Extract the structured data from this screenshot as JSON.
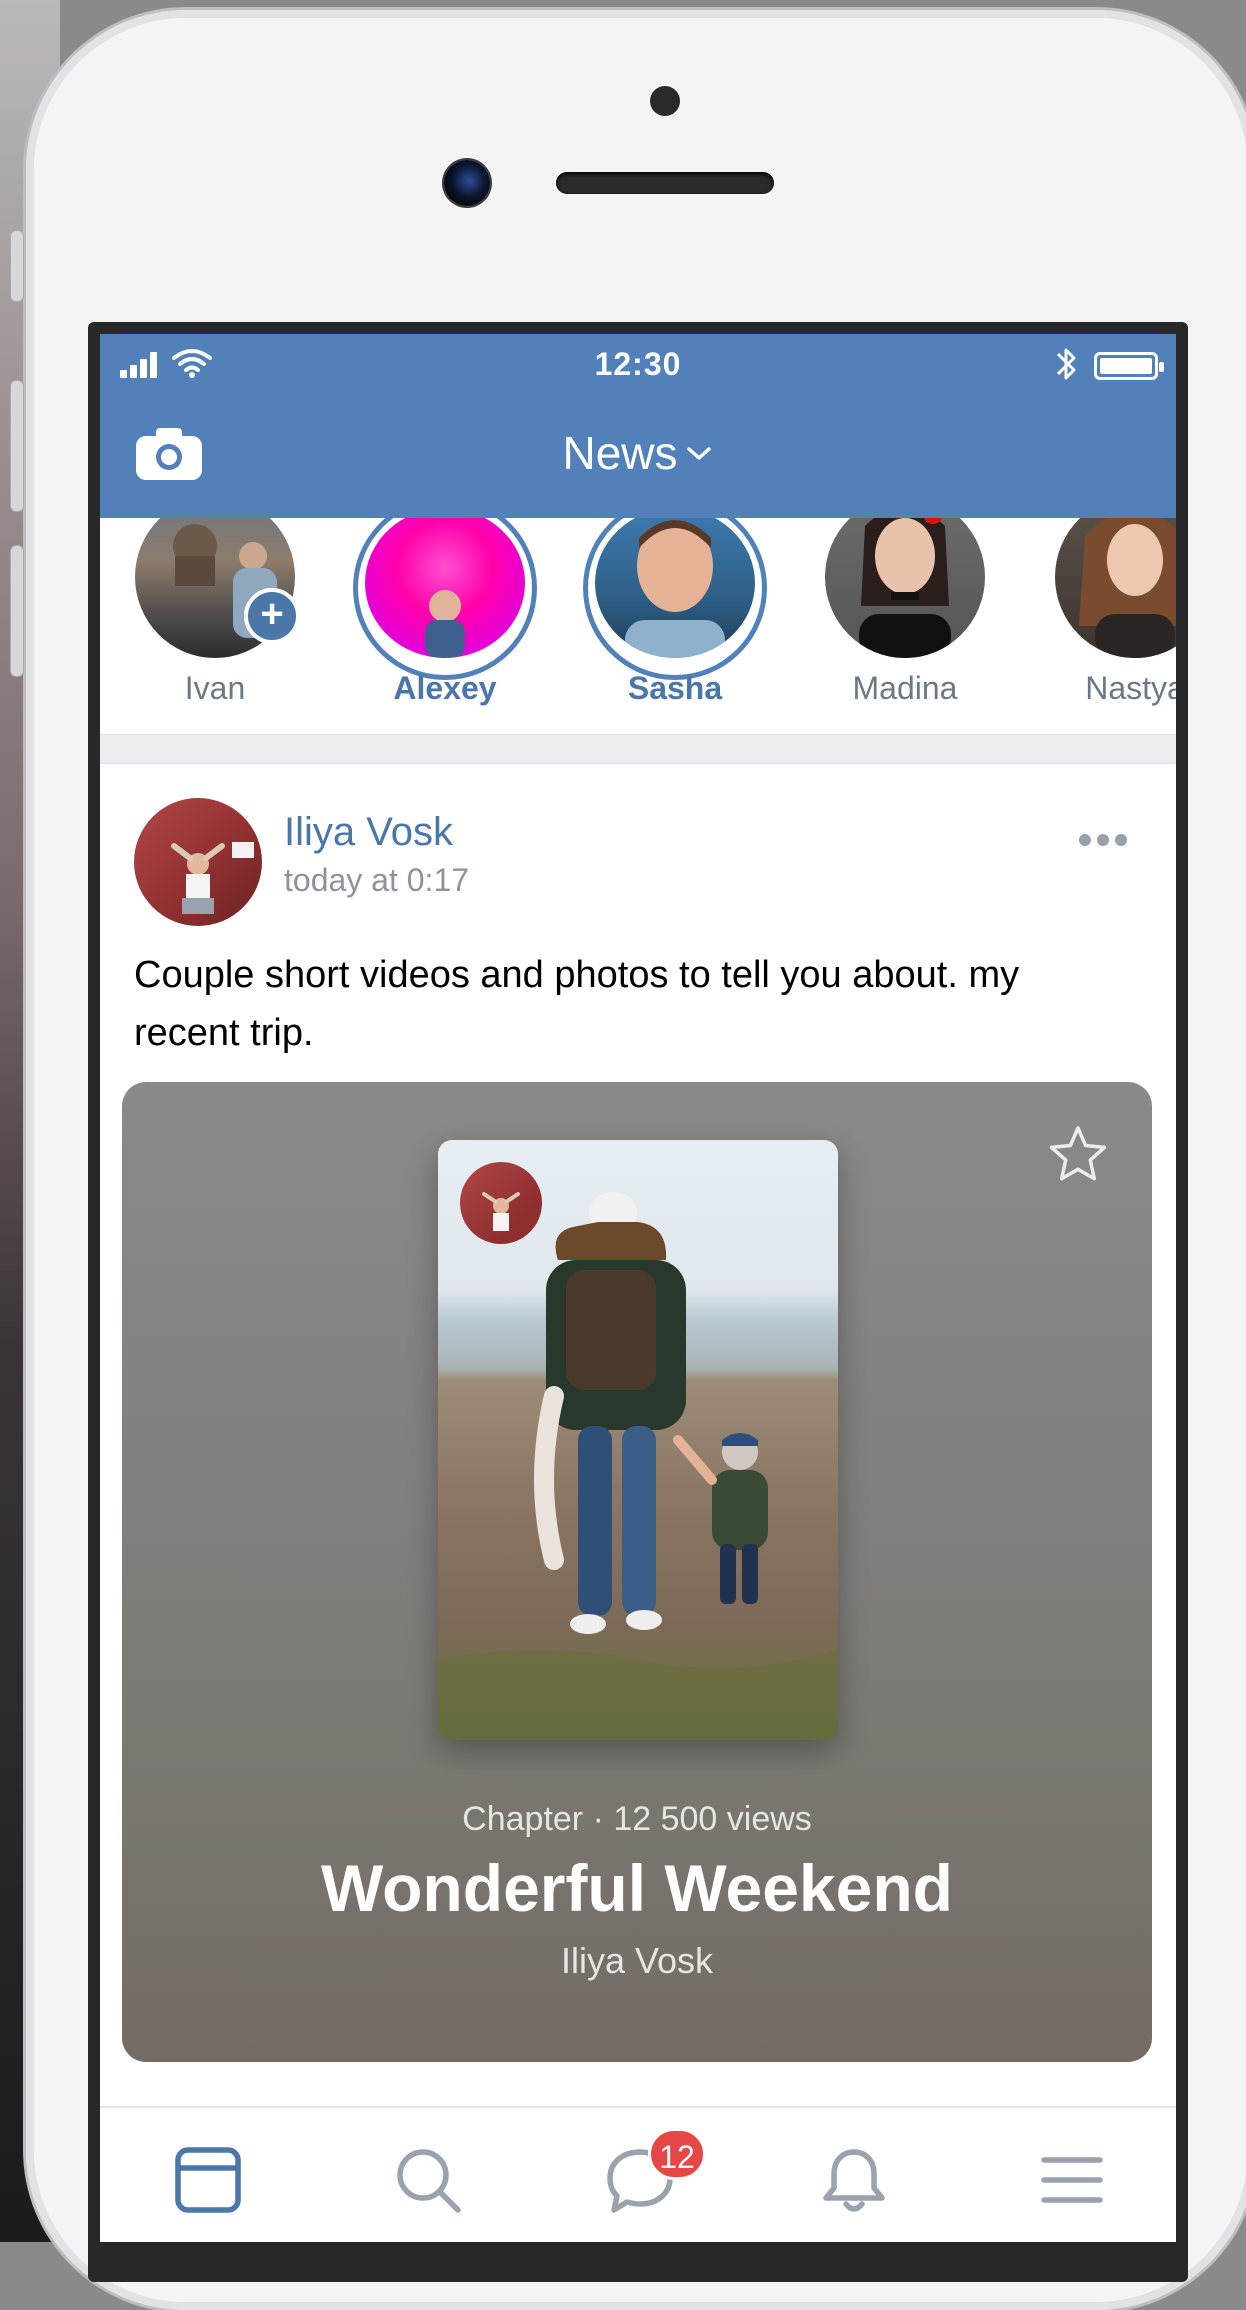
{
  "status_bar": {
    "time": "12:30"
  },
  "header": {
    "title": "News"
  },
  "stories": [
    {
      "name": "Ivan",
      "active": false
    },
    {
      "name": "Alexey",
      "active": true
    },
    {
      "name": "Sasha",
      "active": true
    },
    {
      "name": "Madina",
      "active": false
    },
    {
      "name": "Nastya",
      "active": false
    }
  ],
  "post": {
    "author": "Iliya Vosk",
    "time": "today at 0:17",
    "text": "Couple short videos and photos to tell you about. my recent trip.",
    "card": {
      "meta": "Chapter · 12 500 views",
      "title": "Wonderful Weekend",
      "author": "Iliya Vosk"
    }
  },
  "tabbar": {
    "items": [
      {
        "icon": "news-feed-icon",
        "active": true
      },
      {
        "icon": "search-icon",
        "active": false
      },
      {
        "icon": "messages-icon",
        "active": false,
        "badge": "12"
      },
      {
        "icon": "notifications-bell-icon",
        "active": false
      },
      {
        "icon": "menu-icon",
        "active": false
      }
    ]
  },
  "colors": {
    "brand": "#5181b8",
    "link": "#4a76a8",
    "badge": "#e64646"
  }
}
